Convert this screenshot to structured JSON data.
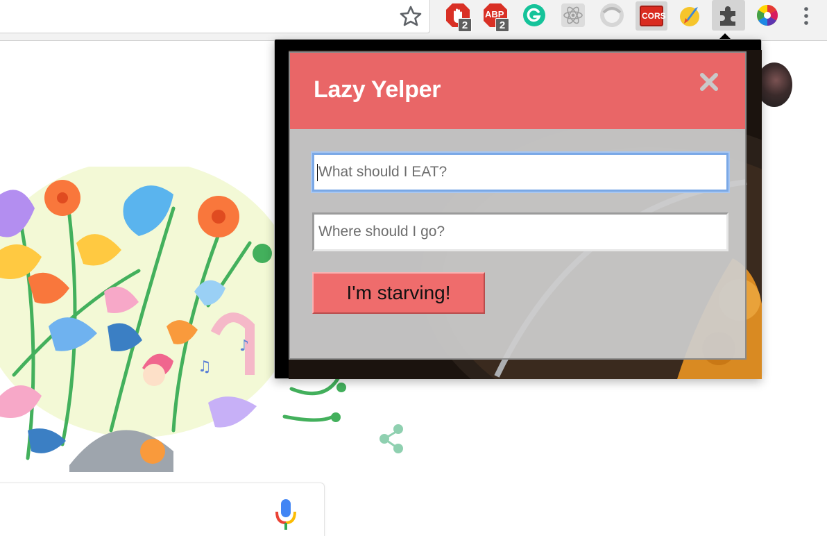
{
  "browser": {
    "extension_badges": {
      "adblock": "2",
      "abp": "2"
    },
    "cors_label": "CORS",
    "abp_label": "ABP"
  },
  "popup": {
    "title": "Lazy Yelper",
    "close_glyph": "✕",
    "food_input": {
      "placeholder": "What should I EAT?",
      "value": ""
    },
    "location_input": {
      "placeholder": "Where should I go?",
      "value": ""
    },
    "submit_label": "I'm starving!"
  },
  "colors": {
    "header": "#e96667",
    "button": "#ef6c6c",
    "focus_ring": "#7aa8e6"
  }
}
